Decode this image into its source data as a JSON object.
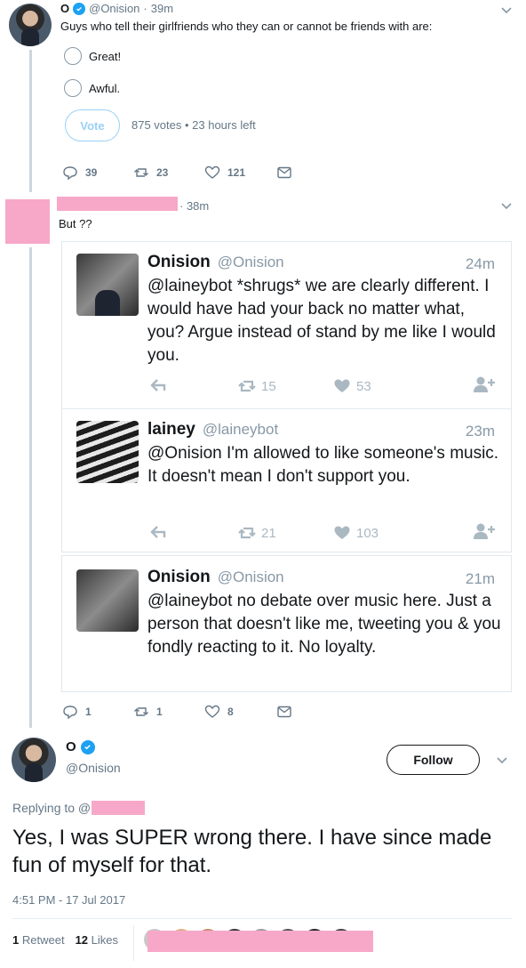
{
  "tweet1": {
    "name": "O",
    "handle": "@Onision",
    "time": "39m",
    "text": "Guys who tell their girlfriends who they can or cannot be friends with are:",
    "poll_options": [
      "Great!",
      "Awful."
    ],
    "vote_label": "Vote",
    "poll_status": "875 votes • 23 hours left",
    "replies": "39",
    "retweets": "23",
    "likes": "121"
  },
  "tweet2": {
    "time": "· 38m",
    "text": "But ??",
    "quoted": [
      {
        "name": "Onision",
        "handle": "@Onision",
        "time": "24m",
        "text": "@laineybot *shrugs* we are clearly different. I would have had your back no matter what, you? Argue instead of stand by me like I would you.",
        "retweets": "15",
        "likes": "53"
      },
      {
        "name": "lainey",
        "handle": "@laineybot",
        "time": "23m",
        "text": "@Onision I'm allowed to like someone's music. It doesn't mean I don't support you.",
        "retweets": "21",
        "likes": "103"
      },
      {
        "name": "Onision",
        "handle": "@Onision",
        "time": "21m",
        "text": "@laineybot no debate over music here. Just a person that doesn't like me, tweeting you & you fondly reacting to it. No loyalty."
      }
    ],
    "replies": "1",
    "retweets": "1",
    "likes": "8"
  },
  "main": {
    "name": "O",
    "handle": "@Onision",
    "follow_label": "Follow",
    "replying_to": "Replying to @",
    "text": "Yes, I was SUPER wrong there. I have since made fun of myself for that.",
    "timestamp": "4:51 PM - 17 Jul 2017",
    "retweet_count": "1",
    "retweet_label": "Retweet",
    "like_count": "12",
    "like_label": "Likes"
  },
  "colors": {
    "accent": "#1da1f2",
    "redaction": "#f7a8c8",
    "muted": "#657786"
  }
}
